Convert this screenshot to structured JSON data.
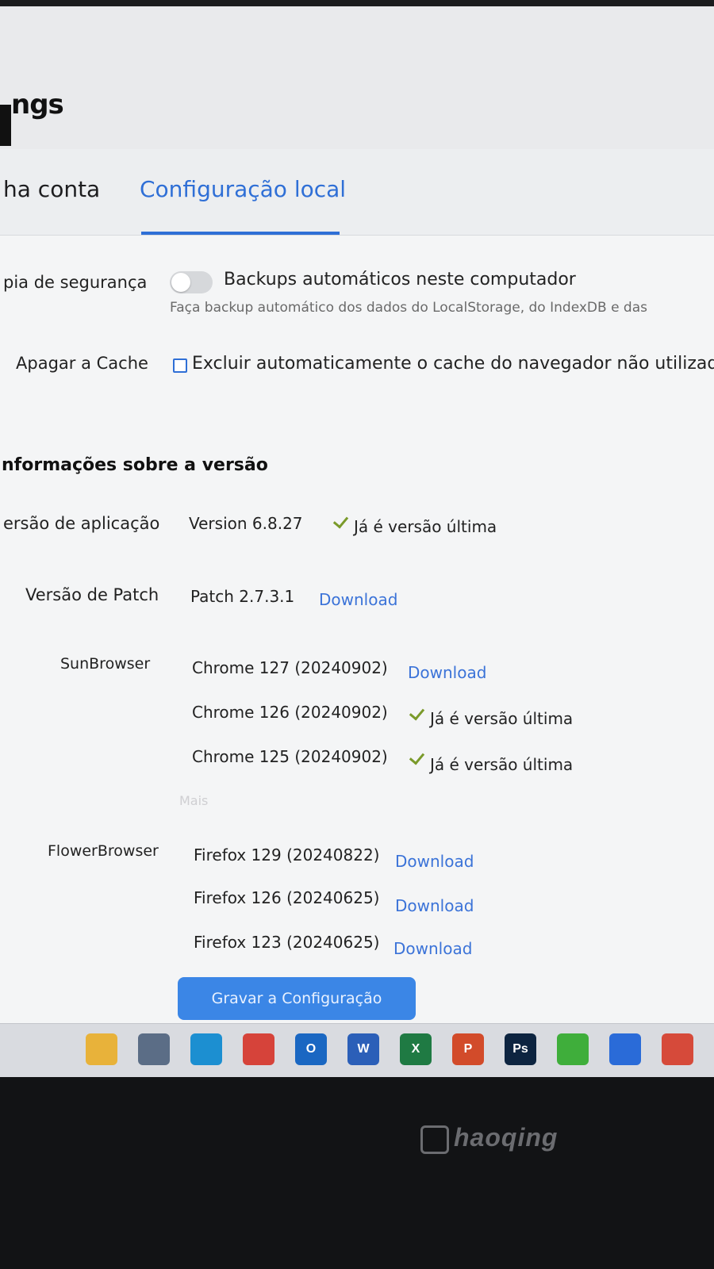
{
  "header": {
    "title": "ngs"
  },
  "tabs": [
    {
      "label": "ha conta",
      "active": false
    },
    {
      "label": "Configuração local",
      "active": true
    }
  ],
  "backup": {
    "label": "pia de segurança",
    "toggle_label": "Backups automáticos neste computador",
    "toggle_on": false,
    "hint": "Faça backup automático dos dados do LocalStorage, do IndexDB e das"
  },
  "cache": {
    "label": "Apagar a Cache",
    "checkbox_label": "Excluir automaticamente o cache do navegador não utilizado",
    "checked": false
  },
  "version_section": {
    "title": "nformações sobre a versão",
    "app": {
      "label": "ersão de aplicação",
      "value": "Version 6.8.27",
      "status": "Já é versão última"
    },
    "patch": {
      "label": "Versão de Patch",
      "value": "Patch 2.7.3.1",
      "action": "Download"
    },
    "sunbrowser": {
      "label": "SunBrowser",
      "items": [
        {
          "name": "Chrome 127 (20240902)",
          "action": "Download"
        },
        {
          "name": "Chrome 126 (20240902)",
          "status": "Já é versão última"
        },
        {
          "name": "Chrome 125 (20240902)",
          "status": "Já é versão última"
        }
      ],
      "more": "Mais"
    },
    "flowerbrowser": {
      "label": "FlowerBrowser",
      "items": [
        {
          "name": "Firefox 129 (20240822)",
          "action": "Download"
        },
        {
          "name": "Firefox 126 (20240625)",
          "action": "Download"
        },
        {
          "name": "Firefox 123 (20240625)",
          "action": "Download"
        }
      ]
    }
  },
  "save_button": "Gravar a Configuração",
  "taskbar": {
    "icons": [
      {
        "name": "file-explorer-icon",
        "color": "#e8b23a",
        "glyph": ""
      },
      {
        "name": "microsoft-store-icon",
        "color": "#5b6d86",
        "glyph": ""
      },
      {
        "name": "edge-icon",
        "color": "#1c8fd1",
        "glyph": ""
      },
      {
        "name": "chrome-icon",
        "color": "#d6433a",
        "glyph": ""
      },
      {
        "name": "outlook-icon",
        "color": "#1a67c2",
        "glyph": "O"
      },
      {
        "name": "word-icon",
        "color": "#2b5fb8",
        "glyph": "W"
      },
      {
        "name": "excel-icon",
        "color": "#1f7a43",
        "glyph": "X"
      },
      {
        "name": "powerpoint-icon",
        "color": "#d24b2a",
        "glyph": "P"
      },
      {
        "name": "photoshop-icon",
        "color": "#0d2440",
        "glyph": "Ps"
      },
      {
        "name": "green-app-icon",
        "color": "#3fae3b",
        "glyph": ""
      },
      {
        "name": "blue-app-icon",
        "color": "#2a6bd8",
        "glyph": ""
      },
      {
        "name": "red-app-icon",
        "color": "#d64a3a",
        "glyph": ""
      }
    ]
  },
  "monitor": {
    "brand": "haoqing"
  }
}
